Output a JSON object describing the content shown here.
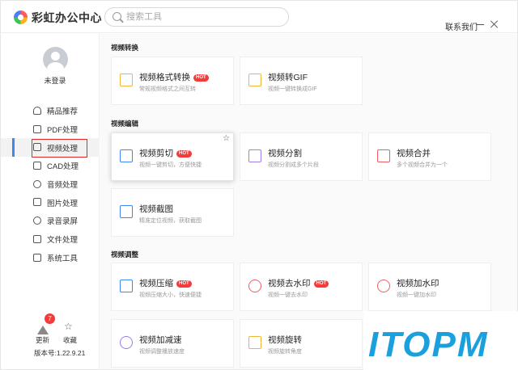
{
  "app": {
    "title": "彩虹办公中心"
  },
  "search": {
    "placeholder": "搜索工具"
  },
  "header": {
    "contact": "联系我们"
  },
  "user": {
    "name": "未登录"
  },
  "sidebar": {
    "items": [
      {
        "label": "精品推荐",
        "icon": "thumb-up-icon"
      },
      {
        "label": "PDF处理",
        "icon": "pdf-icon"
      },
      {
        "label": "视频处理",
        "icon": "video-icon",
        "active": true
      },
      {
        "label": "CAD处理",
        "icon": "cad-icon"
      },
      {
        "label": "音频处理",
        "icon": "music-icon"
      },
      {
        "label": "图片处理",
        "icon": "image-icon"
      },
      {
        "label": "录音录屏",
        "icon": "record-icon"
      },
      {
        "label": "文件处理",
        "icon": "folder-icon"
      },
      {
        "label": "系统工具",
        "icon": "system-icon"
      }
    ],
    "update_label": "更新",
    "update_badge": "7",
    "fav_label": "收藏",
    "version": "版本号:1.22.9.21"
  },
  "sections": {
    "convert": {
      "title": "视频转换"
    },
    "edit": {
      "title": "视频编辑"
    },
    "adjust": {
      "title": "视频调整"
    }
  },
  "cards": {
    "format": {
      "title": "视频格式转换",
      "desc": "常规视频格式之间互转",
      "hot": "HOT"
    },
    "gif": {
      "title": "视频转GIF",
      "desc": "视频一键转换成GIF"
    },
    "cut": {
      "title": "视频剪切",
      "desc": "视频一键剪切，方便快捷",
      "hot": "HOT"
    },
    "split": {
      "title": "视频分割",
      "desc": "视频分割成多个片段"
    },
    "merge": {
      "title": "视频合并",
      "desc": "多个视频合并为一个"
    },
    "screenshot": {
      "title": "视频截图",
      "desc": "精准定位视频，获取截图"
    },
    "compress": {
      "title": "视频压缩",
      "desc": "视频压缩大小，快速便捷",
      "hot": "HOT"
    },
    "remove_wm": {
      "title": "视频去水印",
      "desc": "视频一键去水印",
      "hot": "HOT"
    },
    "add_wm": {
      "title": "视频加水印",
      "desc": "视频一键加水印"
    },
    "speed": {
      "title": "视频加减速",
      "desc": "视频调整播放速度"
    },
    "rotate": {
      "title": "视频旋转",
      "desc": "视频旋转角度"
    }
  },
  "watermark": {
    "text": "ITOPM",
    "color": "#1aa0dc"
  },
  "colors": {
    "accent": "#3d86f6",
    "hot": "#f23b3b",
    "highlight": "#e32626"
  }
}
